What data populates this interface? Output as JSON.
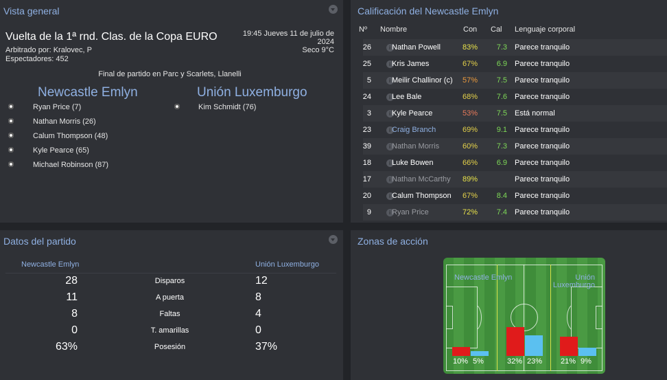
{
  "overview": {
    "title": "Vista general",
    "competition": "Vuelta de la 1ª rnd. Clas. de la Copa EURO",
    "datetime_line1": "19:45 Jueves 11 de julio de",
    "datetime_line2": "2024",
    "weather": "Seco 9°C",
    "referee": "Arbitrado por: Kralovec, P",
    "attendance": "Espectadores: 452",
    "result": "Final de partido en Parc y Scarlets, Llanelli",
    "home_team": "Newcastle Emlyn",
    "away_team": "Unión Luxemburgo",
    "home_scorers": [
      "Ryan Price (7)",
      "Nathan Morris (26)",
      "Calum Thompson (48)",
      "Kyle Pearce (65)",
      "Michael Robinson (87)"
    ],
    "away_scorers": [
      "Kim Schmidt (76)"
    ]
  },
  "ratings": {
    "title": "Calificación del Newcastle Emlyn",
    "headers": {
      "num": "Nº",
      "name": "Nombre",
      "con": "Con",
      "cal": "Cal",
      "body": "Lenguaje corporal"
    },
    "rows": [
      {
        "num": "26",
        "name": "Nathan Powell",
        "con": "83%",
        "cal": "7.3",
        "body": "Parece tranquilo"
      },
      {
        "num": "25",
        "name": "Kris James",
        "con": "67%",
        "cal": "6.9",
        "body": "Parece tranquilo"
      },
      {
        "num": "5",
        "name": "Meilir Challinor (c)",
        "con": "57%",
        "cal": "7.5",
        "body": "Parece tranquilo"
      },
      {
        "num": "24",
        "name": "Lee Bale",
        "con": "68%",
        "cal": "7.6",
        "body": "Parece tranquilo"
      },
      {
        "num": "3",
        "name": "Kyle Pearce",
        "con": "53%",
        "cal": "7.5",
        "body": "Está normal"
      },
      {
        "num": "23",
        "name": "Craig Branch",
        "con": "69%",
        "cal": "9.1",
        "body": "Parece tranquilo"
      },
      {
        "num": "39",
        "name": "Nathan Morris",
        "con": "60%",
        "cal": "7.3",
        "body": "Parece tranquilo"
      },
      {
        "num": "18",
        "name": "Luke Bowen",
        "con": "66%",
        "cal": "6.9",
        "body": "Parece tranquilo"
      },
      {
        "num": "17",
        "name": "Nathan McCarthy",
        "con": "89%",
        "cal": "",
        "body": "Parece tranquilo"
      },
      {
        "num": "20",
        "name": "Calum Thompson",
        "con": "67%",
        "cal": "8.4",
        "body": "Parece tranquilo"
      },
      {
        "num": "9",
        "name": "Ryan Price",
        "con": "72%",
        "cal": "7.4",
        "body": "Parece tranquilo"
      }
    ]
  },
  "match_stats": {
    "title": "Datos del partido",
    "home_team": "Newcastle Emlyn",
    "away_team": "Unión Luxemburgo",
    "rows": [
      {
        "label": "Disparos",
        "home": "28",
        "away": "12"
      },
      {
        "label": "A puerta",
        "home": "11",
        "away": "8"
      },
      {
        "label": "Faltas",
        "home": "8",
        "away": "4"
      },
      {
        "label": "T. amarillas",
        "home": "0",
        "away": "0"
      },
      {
        "label": "Posesión",
        "home": "63%",
        "away": "37%"
      }
    ]
  },
  "action_zones": {
    "title": "Zonas de acción",
    "home_team": "Newcastle Emlyn",
    "away_team_line1": "Unión",
    "away_team_line2": "Luxemburgo",
    "zones": [
      {
        "home": "10%",
        "away": "5%"
      },
      {
        "home": "32%",
        "away": "23%"
      },
      {
        "home": "21%",
        "away": "9%"
      }
    ],
    "colors": {
      "home": "#e01b1b",
      "away": "#5bc0f0"
    }
  }
}
